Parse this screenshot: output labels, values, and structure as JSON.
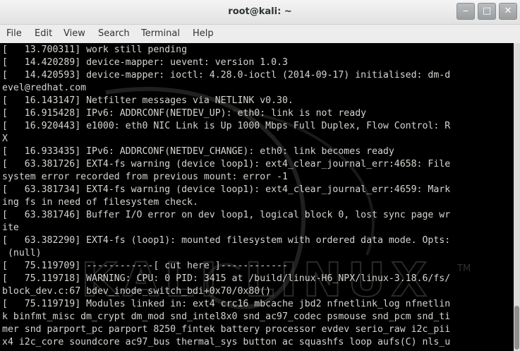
{
  "window": {
    "title": "root@kali: ~",
    "minimize_label": "‒",
    "maximize_label": "□",
    "close_label": "✕"
  },
  "menubar": {
    "items": [
      "File",
      "Edit",
      "View",
      "Search",
      "Terminal",
      "Help"
    ]
  },
  "terminal": {
    "lines": [
      "[   13.700311] work still pending",
      "[   14.420289] device-mapper: uevent: version 1.0.3",
      "[   14.420593] device-mapper: ioctl: 4.28.0-ioctl (2014-09-17) initialised: dm-d",
      "evel@redhat.com",
      "[   16.143147] Netfilter messages via NETLINK v0.30.",
      "[   16.915428] IPv6: ADDRCONF(NETDEV_UP): eth0: link is not ready",
      "[   16.920443] e1000: eth0 NIC Link is Up 1000 Mbps Full Duplex, Flow Control: R",
      "X",
      "[   16.933435] IPv6: ADDRCONF(NETDEV_CHANGE): eth0: link becomes ready",
      "[   63.381726] EXT4-fs warning (device loop1): ext4_clear_journal_err:4658: File",
      "system error recorded from previous mount: error -1",
      "[   63.381734] EXT4-fs warning (device loop1): ext4_clear_journal_err:4659: Mark",
      "ing fs in need of filesystem check.",
      "[   63.381746] Buffer I/O error on dev loop1, logical block 0, lost sync page wr",
      "ite",
      "[   63.382290] EXT4-fs (loop1): mounted filesystem with ordered data mode. Opts:",
      " (null)",
      "[   75.119709] ------------[ cut here ]------------",
      "[   75.119718] WARNING: CPU: 0 PID: 3415 at /build/linux-H6_NPX/linux-3.18.6/fs/",
      "block_dev.c:67 bdev_inode_switch_bdi+0x70/0x80()",
      "[   75.119719] Modules linked in: ext4 crc16 mbcache jbd2 nfnetlink_log nfnetlin",
      "k binfmt_misc dm_crypt dm_mod snd_intel8x0 snd_ac97_codec psmouse snd_pcm snd_ti",
      "mer snd parport_pc parport 8250_fintek battery processor evdev serio_raw i2c_pii",
      "x4 i2c_core soundcore ac97_bus thermal_sys button ac squashfs loop aufs(C) nls_u"
    ]
  },
  "watermark": {
    "text": "KALI LINUX",
    "mark": "TM"
  }
}
